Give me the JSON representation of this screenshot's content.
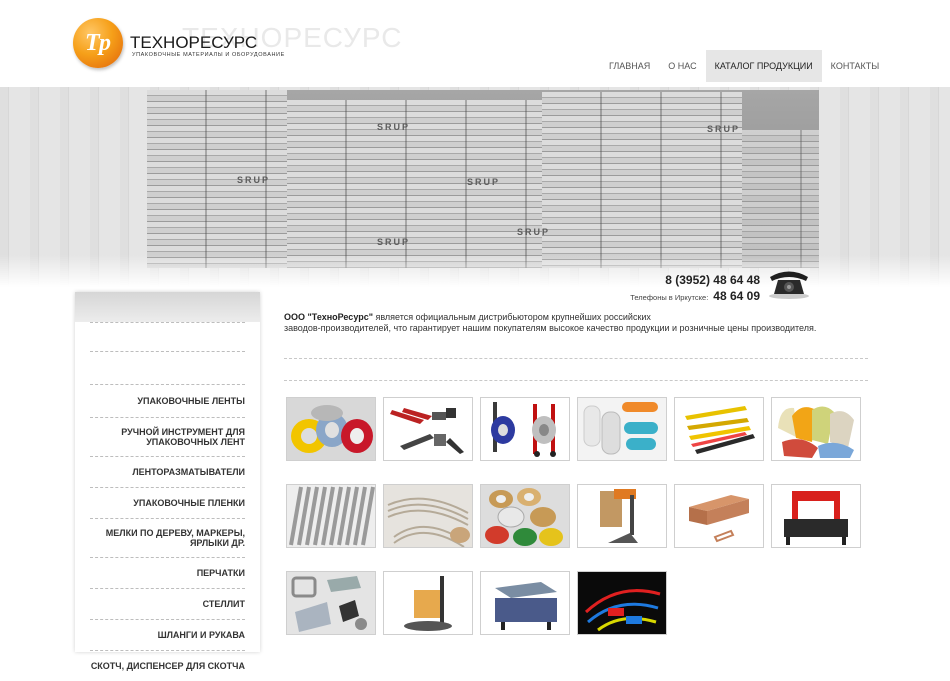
{
  "header": {
    "logo_letters": "Тр",
    "logo_title": "ТЕХНОРЕСУРС",
    "logo_subtitle": "УПАКОВОЧНЫЕ МАТЕРИАЛЫ И ОБОРУДОВАНИЕ",
    "nav": [
      {
        "label": "ГЛАВНАЯ",
        "active": false
      },
      {
        "label": "О НАС",
        "active": false
      },
      {
        "label": "КАТАЛОГ ПРОДУКЦИИ",
        "active": true
      },
      {
        "label": "КОНТАКТЫ",
        "active": false
      }
    ]
  },
  "banner": {
    "stack_marks": [
      "SRUP",
      "SRUP",
      "SRUP",
      "SRUP",
      "SRUP",
      "SRUP"
    ]
  },
  "contact": {
    "phone_main": "8 (3952) 48 64 48",
    "phone_label": "Телефоны в Иркутске:",
    "phone_second": "48 64 09"
  },
  "sidebar": {
    "items": [
      "",
      "УПАКОВОЧНЫЕ ЛЕНТЫ",
      "РУЧНОЙ ИНСТРУМЕНТ ДЛЯ УПАКОВОЧНЫХ ЛЕНТ",
      "ЛЕНТОРАЗМАТЫВАТЕЛИ",
      "УПАКОВОЧНЫЕ ПЛЕНКИ",
      "МЕЛКИ ПО ДЕРЕВУ, МАРКЕРЫ, ЯРЛЫКИ ДР.",
      "ПЕРЧАТКИ",
      "СТЕЛЛИТ",
      "ШЛАНГИ И РУКАВА",
      "СКОТЧ, ДИСПЕНСЕР ДЛЯ СКОТЧА"
    ]
  },
  "main": {
    "intro_company": "ООО \"ТехноРесурс\"",
    "intro_text_1": " является официальным дистрибьютором крупнейших российских",
    "intro_text_2": "заводов-производителей, что гарантирует нашим покупателям высокое качество продукции и розничные цены производителя."
  },
  "products": [
    {
      "icon": "strapping-tape-rolls-icon"
    },
    {
      "icon": "strapping-hand-tools-icon"
    },
    {
      "icon": "tape-dispenser-cart-icon"
    },
    {
      "icon": "stretch-film-rolls-icon"
    },
    {
      "icon": "wood-markers-icon"
    },
    {
      "icon": "work-gloves-icon"
    },
    {
      "icon": "steel-rods-icon"
    },
    {
      "icon": "flexible-hoses-icon"
    },
    {
      "icon": "adhesive-tape-rolls-icon"
    },
    {
      "icon": "carton-stapler-icon"
    },
    {
      "icon": "staples-icon"
    },
    {
      "icon": "strapping-machine-icon"
    },
    {
      "icon": "strap-buckles-icon"
    },
    {
      "icon": "pallet-wrapper-icon"
    },
    {
      "icon": "shrink-wrap-machine-icon"
    },
    {
      "icon": "security-seals-icon"
    }
  ]
}
